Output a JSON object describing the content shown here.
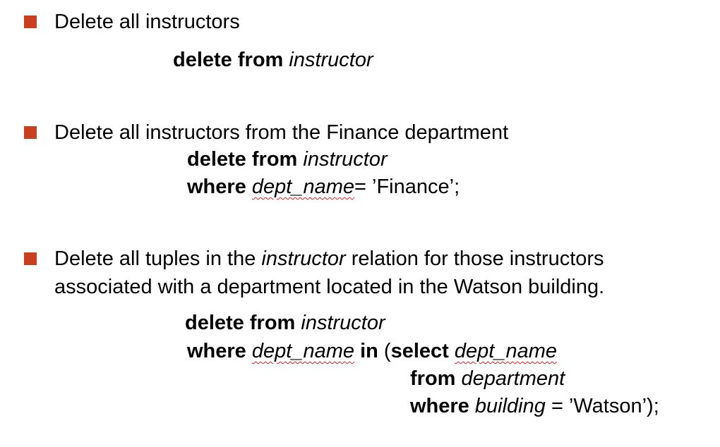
{
  "bullet_color": "#c8401f",
  "sections": [
    {
      "text": "Delete all instructors",
      "query": {
        "kw_delete_from": "delete from",
        "relation": "instructor"
      }
    },
    {
      "text": "Delete all instructors from the Finance department",
      "query": {
        "kw_delete_from": "delete from",
        "relation": "instructor",
        "kw_where": "where",
        "attr": "dept_name",
        "rest": "= ’Finance’;"
      }
    },
    {
      "text_pre": "Delete all tuples in the ",
      "text_italic": "instructor",
      "text_post": " relation for those instructors",
      "text_line2": "associated with a department located in the Watson building.",
      "query": {
        "kw_delete_from": "delete from",
        "relation": "instructor",
        "kw_where": "where",
        "attr": "dept_name",
        "kw_in": "in",
        "open_paren": "(",
        "kw_select": "select",
        "sub_attr": "dept_name",
        "kw_from": "from",
        "sub_relation": "department",
        "kw_where2": "where",
        "cond_attr": "building",
        "cond_rest": "= ’Watson’);"
      }
    }
  ]
}
